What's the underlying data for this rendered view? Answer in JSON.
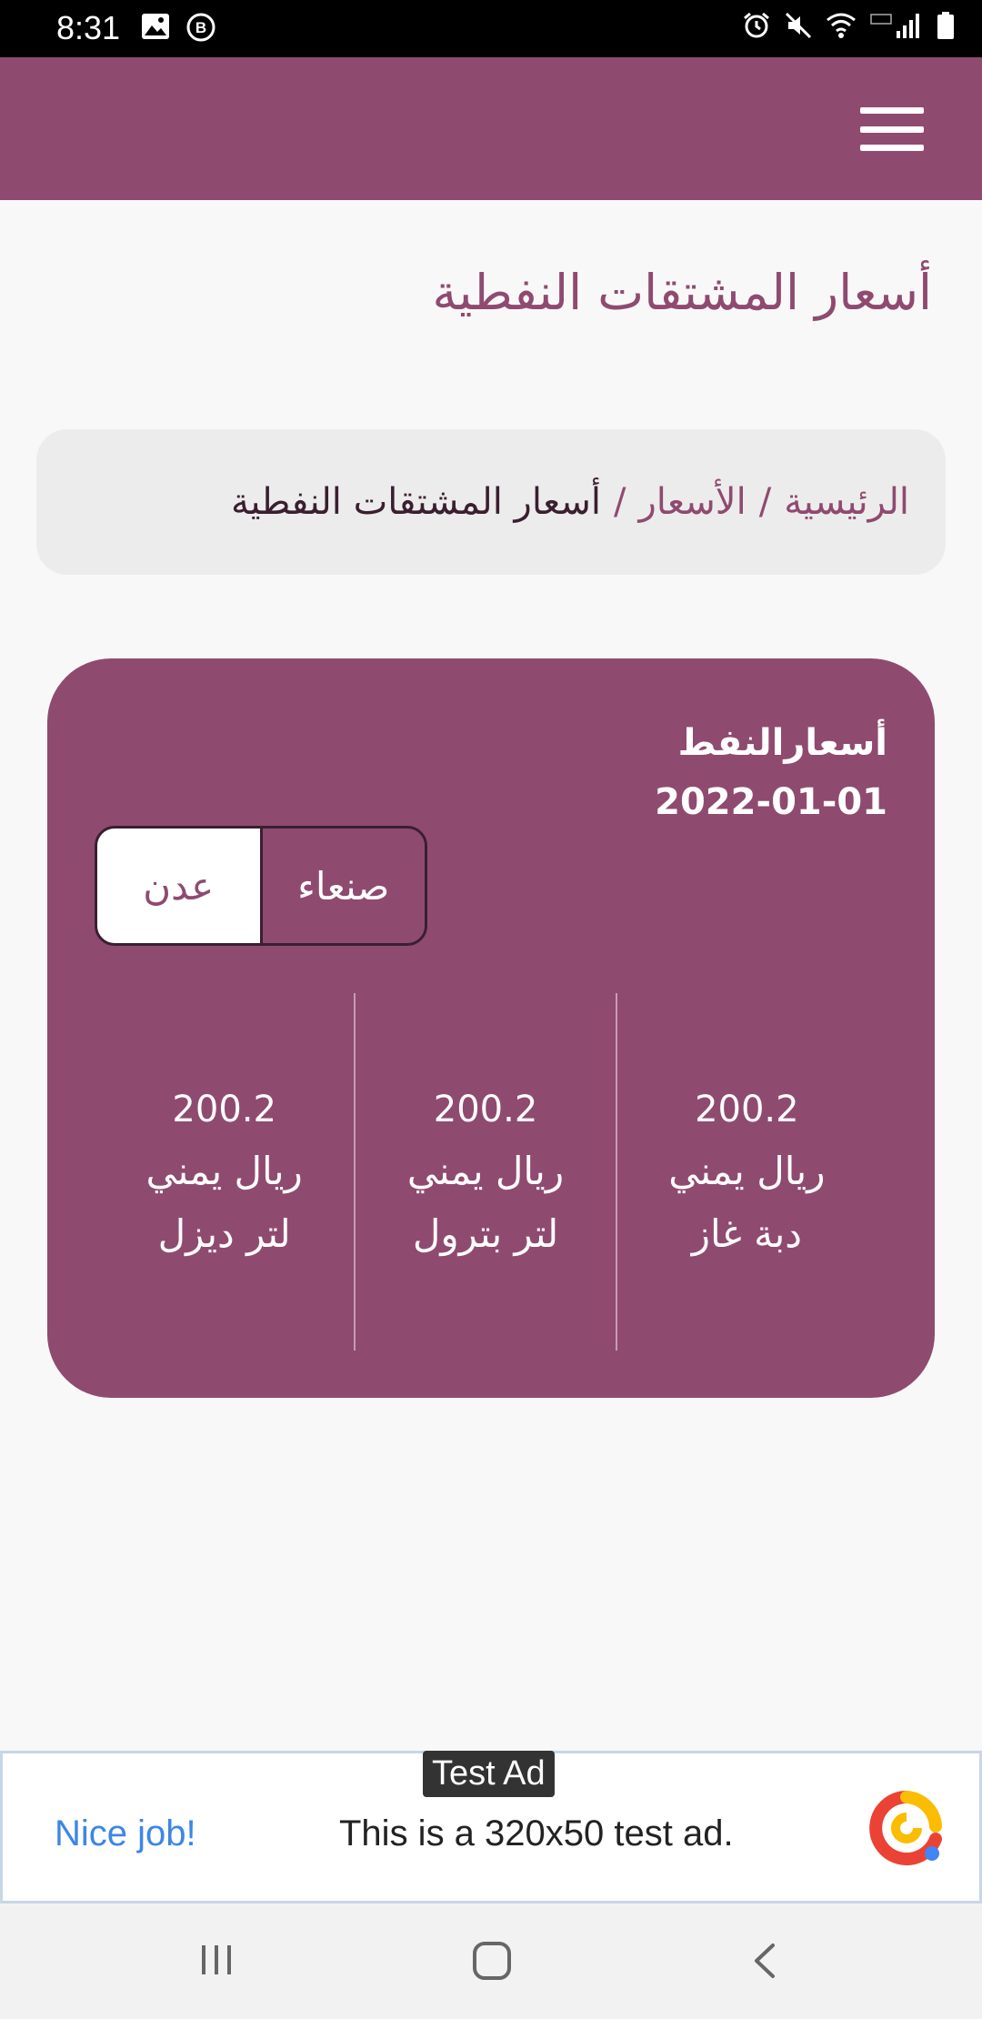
{
  "status_bar": {
    "time": "8:31"
  },
  "icons": {
    "menu": "menu-icon",
    "gallery": "gallery-icon",
    "b_notification": "b-notification-icon",
    "alarm": "alarm-icon",
    "mute": "mute-icon",
    "wifi": "wifi-icon",
    "signal": "signal-icon",
    "battery": "battery-icon",
    "ad_logo": "ad-logo-icon",
    "nav_recents": "recents-icon",
    "nav_home": "home-icon",
    "nav_back": "back-icon"
  },
  "colors": {
    "brand": "#8f4a70",
    "dark": "#3a1f30",
    "ad_cta": "#3c86e6"
  },
  "page": {
    "title": "أسعار المشتقات النفطية"
  },
  "breadcrumb": {
    "home": "الرئيسية",
    "prices": "الأسعار",
    "current": "أسعار المشتقات النفطية",
    "separator": "/"
  },
  "card": {
    "title": "أسعارالنفط",
    "date": "2022-01-01",
    "cities": {
      "sanaa": "صنعاء",
      "aden": "عدن",
      "selected": "عدن"
    },
    "prices": [
      {
        "value": "200.2",
        "currency": "ريال يمني",
        "unit": "دبة غاز"
      },
      {
        "value": "200.2",
        "currency": "ريال يمني",
        "unit": "لتر بترول"
      },
      {
        "value": "200.2",
        "currency": "ريال يمني",
        "unit": "لتر ديزل"
      }
    ]
  },
  "ad": {
    "badge": "Test Ad",
    "cta": "Nice job!",
    "text": "This is a 320x50 test ad."
  }
}
